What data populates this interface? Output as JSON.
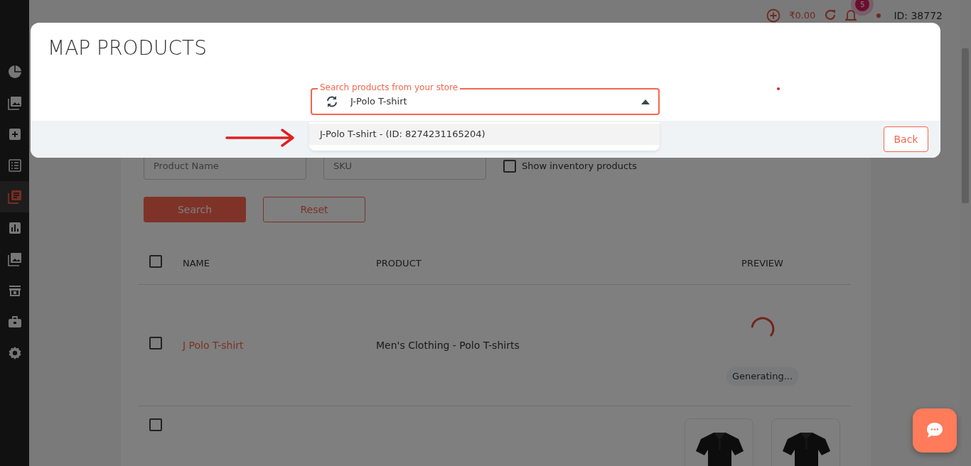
{
  "sidebar": {
    "items": [
      {
        "kind": "pie",
        "selected": false
      },
      {
        "kind": "images",
        "selected": false
      },
      {
        "kind": "plus",
        "selected": false
      },
      {
        "kind": "list",
        "selected": false
      },
      {
        "kind": "catalog",
        "selected": true
      },
      {
        "kind": "chart",
        "selected": false
      },
      {
        "kind": "images",
        "selected": false
      },
      {
        "kind": "store",
        "selected": false
      },
      {
        "kind": "briefcase",
        "selected": false
      },
      {
        "kind": "gear",
        "selected": false
      }
    ]
  },
  "header": {
    "balance": "₹0.00",
    "notification_count": "5",
    "account_id": "ID: 38772"
  },
  "filters": {
    "product_name": {
      "placeholder": "Product Name"
    },
    "sku": {
      "placeholder": "SKU"
    },
    "show_inventory": {
      "label": "Show inventory products",
      "checked": false
    }
  },
  "buttons": [
    {
      "label": "Search",
      "kind": "primary"
    },
    {
      "label": "Reset",
      "kind": "outline"
    }
  ],
  "table": {
    "all_checked": false,
    "columns": [
      "NAME",
      "PRODUCT",
      "PREVIEW"
    ],
    "rows": [
      {
        "checked": false,
        "name": "J Polo T-shirt",
        "product": "Men's Clothing - Polo T-shirts",
        "preview": {
          "kind": "generating",
          "status": "Generating..."
        }
      },
      {
        "checked": false,
        "preview": {
          "kind": "images"
        }
      }
    ]
  },
  "modal": {
    "title": "MAP PRODUCTS",
    "search": {
      "label": "Search products from your store",
      "value": "J-Polo T-shirt",
      "expanded": true
    },
    "options": [
      {
        "label": "J-Polo T-shirt - (ID: 8274231165204)",
        "selected": true
      }
    ],
    "back_button": "Back"
  }
}
